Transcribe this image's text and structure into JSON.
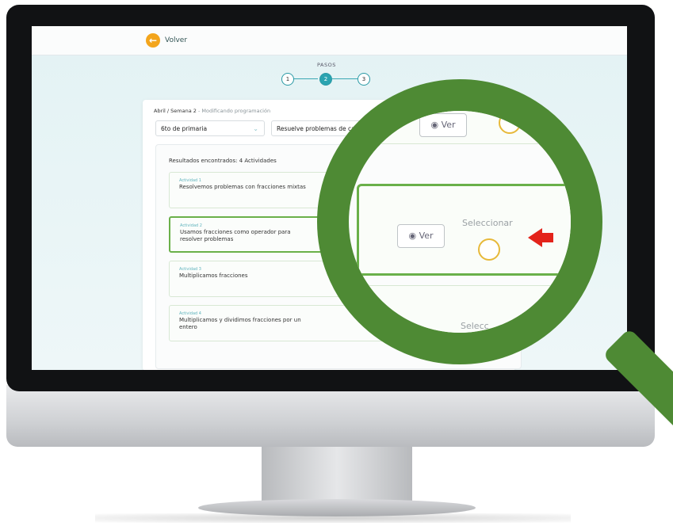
{
  "topbar": {
    "back_label": "Volver"
  },
  "steps": {
    "title": "PASOS",
    "items": [
      "1",
      "2",
      "3"
    ],
    "active_index": 1
  },
  "breadcrumb": {
    "path": "Abril / Semana 2",
    "suffix": " - Modificando programación"
  },
  "filters": {
    "grade": "6to de primaria",
    "topic": "Resuelve problemas de cantidad"
  },
  "results": {
    "label": "Resultados encontrados: 4 Actividades",
    "activities": [
      {
        "number": "Actividad 1",
        "title": "Resolvemos problemas con fracciones mixtas"
      },
      {
        "number": "Actividad 2",
        "title": "Usamos fracciones como operador para resolver problemas"
      },
      {
        "number": "Actividad 3",
        "title": "Multiplicamos fracciones"
      },
      {
        "number": "Actividad 4",
        "title": "Multiplicamos y dividimos fracciones por un entero"
      }
    ],
    "selected_index": 1
  },
  "magnified": {
    "view_label": "Ver",
    "select_label": "Seleccionar",
    "select_partial": "Selecc"
  },
  "colors": {
    "accent_teal": "#2aa3b0",
    "selected_green": "#6ab04a",
    "magnifier_green": "#4e8a34",
    "arrow_red": "#e3231b",
    "back_orange": "#f3a51c"
  },
  "icons": {
    "back": "arrow-left-icon",
    "view": "eye-icon",
    "select": "radio-circle-icon",
    "dropdown": "chevron-down-icon",
    "magnifier": "magnifying-glass-icon",
    "pointer": "red-arrow-icon"
  }
}
